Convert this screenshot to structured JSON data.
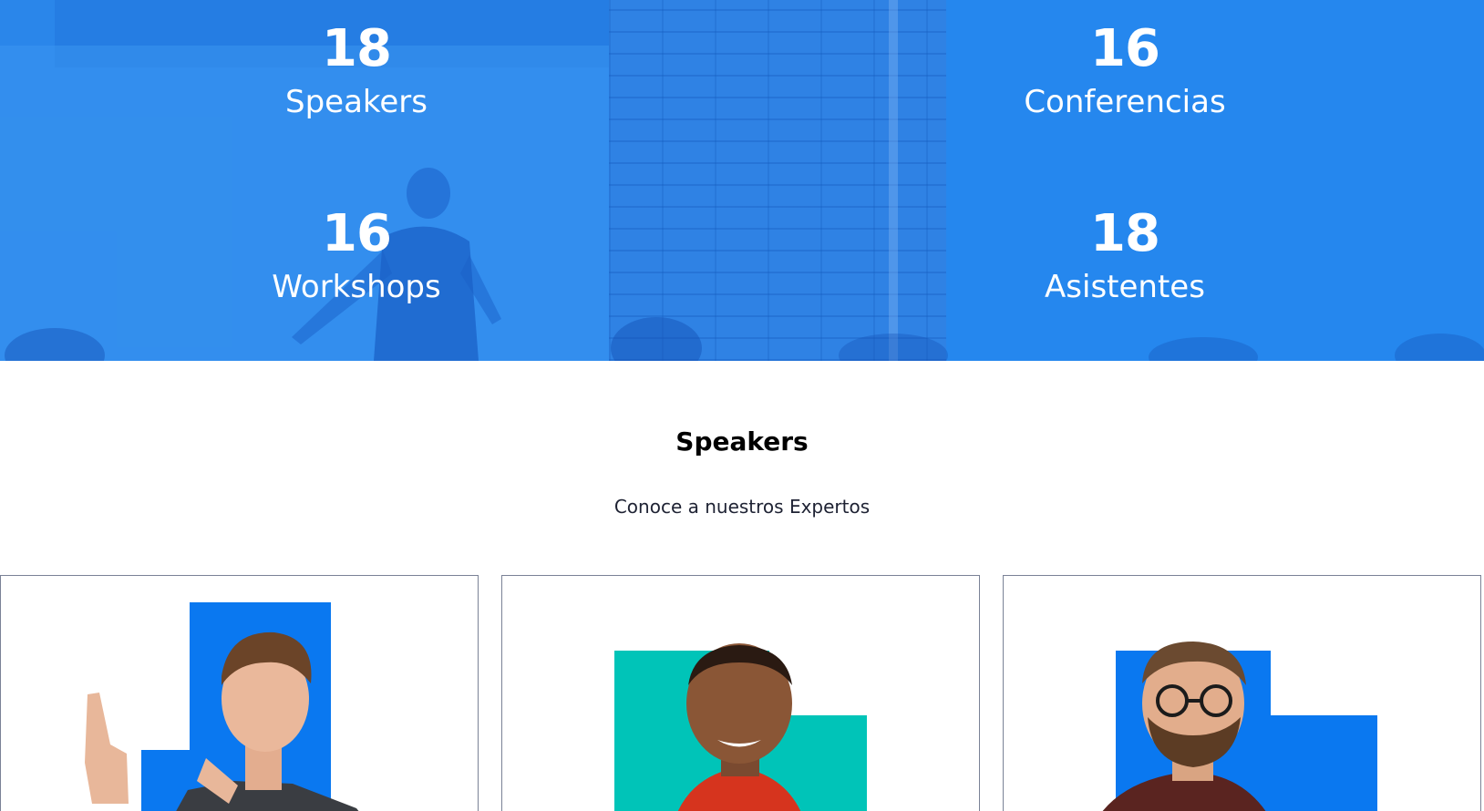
{
  "stats": [
    {
      "number": "18",
      "label": "Speakers"
    },
    {
      "number": "16",
      "label": "Conferencias"
    },
    {
      "number": "16",
      "label": "Workshops"
    },
    {
      "number": "18",
      "label": "Asistentes"
    }
  ],
  "speakers_section": {
    "title": "Speakers",
    "subtitle": "Conoce a nuestros Expertos"
  },
  "colors": {
    "brand_blue": "#2a86ea",
    "accent_blue": "#0a78f0",
    "accent_teal": "#00c4b8",
    "border": "#7a8296"
  }
}
